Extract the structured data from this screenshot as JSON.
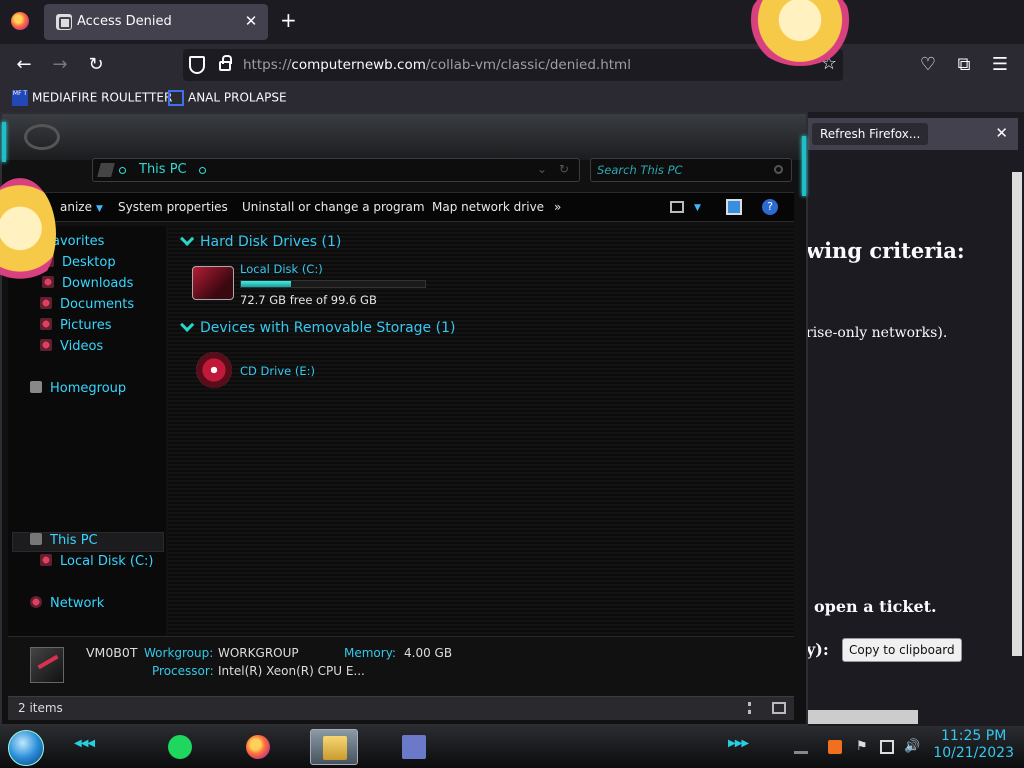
{
  "browser": {
    "tab_title": "Access Denied",
    "tab_close": "✕",
    "new_tab": "+",
    "url_scheme": "https://",
    "url_host": "computernewb.com",
    "url_path": "/collab-vm/classic/denied.html",
    "bookmarks": [
      {
        "label": "MEDIAFIRE ROULETTER",
        "icon": "mediafire-icon",
        "icon_text": "MF T"
      },
      {
        "label": "ANAL PROLAPSE",
        "icon": "bookmark-page-icon"
      }
    ]
  },
  "webpage": {
    "notice_button": "Refresh Firefox...",
    "notice_close": "✕",
    "heading_fragment": "wing criteria:",
    "text_fragment": "rise-only networks).",
    "ticket_fragment": "open a ticket.",
    "key_fragment": "y):",
    "copy_button": "Copy to clipboard"
  },
  "explorer": {
    "address": "This PC",
    "search_placeholder": "Search This PC",
    "toolbar": {
      "organize": "anize",
      "system_properties": "System properties",
      "uninstall": "Uninstall or change a program",
      "map_drive": "Map network drive",
      "more": "»"
    },
    "nav": {
      "favorites": "avorites",
      "desktop": "Desktop",
      "downloads": "Downloads",
      "documents": "Documents",
      "pictures": "Pictures",
      "videos": "Videos",
      "homegroup": "Homegroup",
      "this_pc": "This PC",
      "local_disk": "Local Disk (C:)",
      "network": "Network"
    },
    "groups": {
      "hdd_header": "Hard Disk Drives (1)",
      "removable_header": "Devices with Removable Storage (1)"
    },
    "drives": {
      "local_disk_name": "Local Disk (C:)",
      "local_disk_free": "72.7 GB free of 99.6 GB",
      "local_disk_used_fraction": 0.27,
      "cd_drive_name": "CD Drive (E:)"
    },
    "details": {
      "computer_name": "VM0B0T",
      "workgroup_label": "Workgroup:",
      "workgroup_value": "WORKGROUP",
      "memory_label": "Memory:",
      "memory_value": "4.00 GB",
      "processor_label": "Processor:",
      "processor_value": "Intel(R) Xeon(R) CPU E..."
    },
    "status": {
      "items": "2 items"
    }
  },
  "taskbar": {
    "time": "11:25 PM",
    "date": "10/21/2023",
    "apps": [
      "notes-app-icon",
      "firefox-icon",
      "file-explorer-icon",
      "window-app-icon"
    ]
  },
  "colors": {
    "accent_cyan": "#36d6ff",
    "firefox_tab": "#42414d",
    "firefox_bg": "#1c1b22"
  }
}
